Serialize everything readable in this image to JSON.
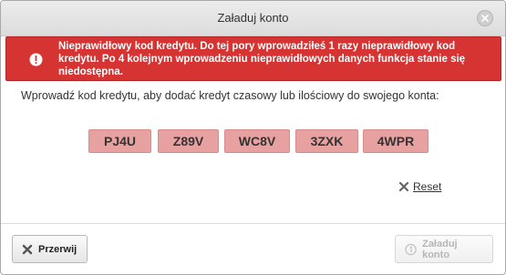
{
  "dialog": {
    "title": "Załaduj konto"
  },
  "error": {
    "message": "Nieprawidłowy kod kredytu. Do tej pory wprowadziłeś 1 razy nieprawidłowy kod kredytu. Po 4 kolejnym wprowadzeniu nieprawidłowych danych funkcja stanie się niedostępna."
  },
  "instruction": "Wprowadź kod kredytu, aby dodać kredyt czasowy lub ilościowy do swojego konta:",
  "code_fields": [
    "PJ4U",
    "Z89V",
    "WC8V",
    "3ZXK",
    "4WPR"
  ],
  "reset_label": "Reset",
  "buttons": {
    "cancel_label": "Przerwij",
    "submit_label": "Załaduj konto"
  },
  "colors": {
    "error_bg": "#d63333",
    "code_field_bg": "#e8a1a1"
  },
  "icons": {
    "close": "close-icon",
    "error": "info-icon",
    "reset": "x-icon",
    "cancel": "x-icon",
    "submit": "coin-icon"
  }
}
